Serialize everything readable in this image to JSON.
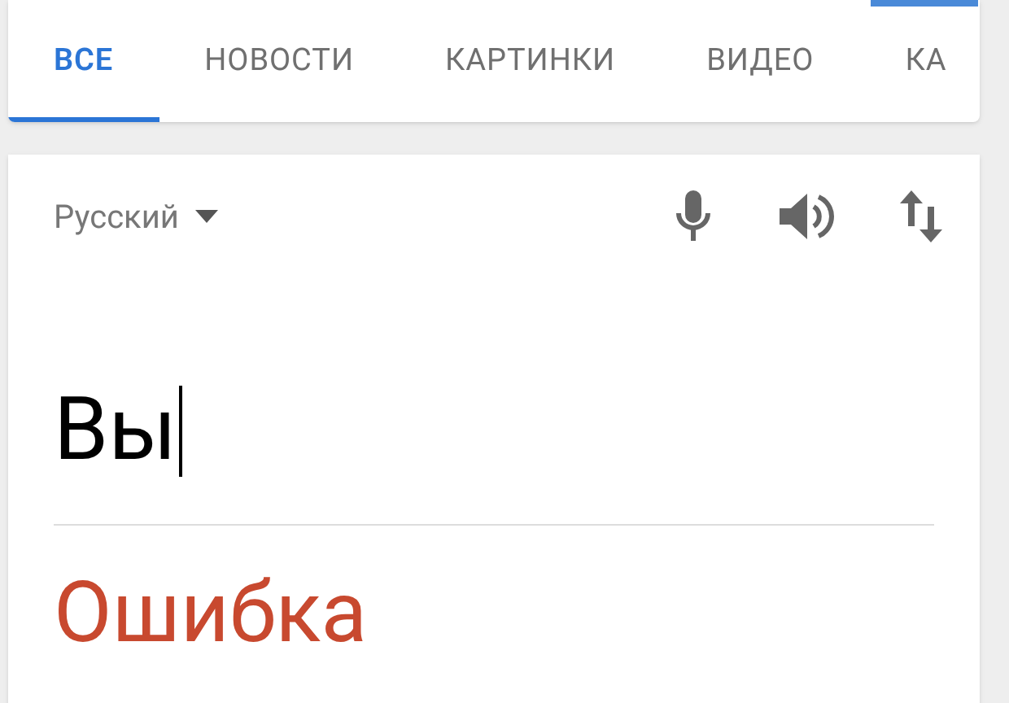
{
  "tabs": [
    {
      "label": "ВСЕ",
      "selected": true
    },
    {
      "label": "НОВОСТИ",
      "selected": false
    },
    {
      "label": "КАРТИНКИ",
      "selected": false
    },
    {
      "label": "ВИДЕО",
      "selected": false
    },
    {
      "label": "КА",
      "selected": false
    }
  ],
  "translator": {
    "source_language": "Русский",
    "input": {
      "value": "Вы"
    },
    "result": "Ошибка"
  }
}
